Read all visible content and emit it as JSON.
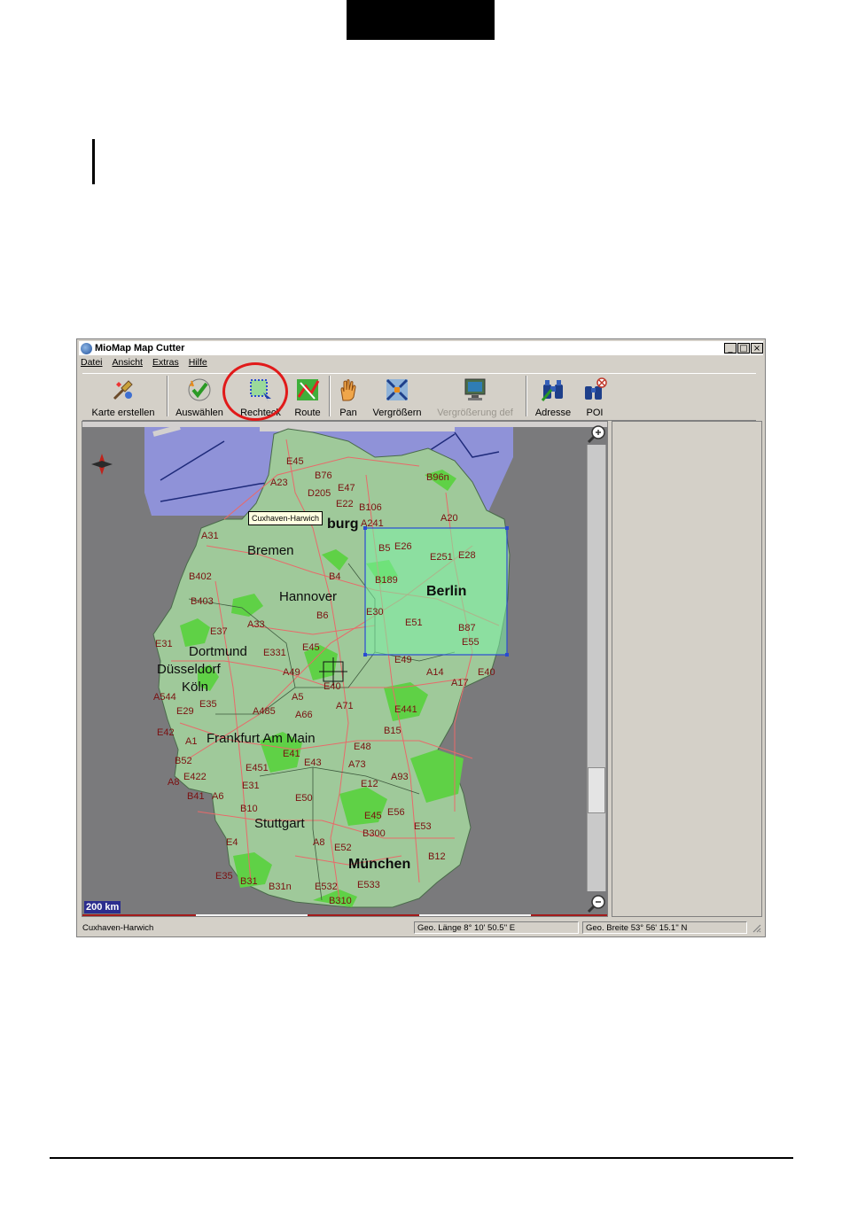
{
  "window": {
    "title": "MioMap Map Cutter",
    "buttons": [
      "_",
      "□",
      "×"
    ]
  },
  "menu": [
    "Datei",
    "Ansicht",
    "Extras",
    "Hilfe"
  ],
  "toolbar": {
    "karte_erstellen": "Karte erstellen",
    "auswaehlen": "Auswählen",
    "rechteck": "Rechteck",
    "route": "Route",
    "pan": "Pan",
    "vergroessern": "Vergrößern",
    "vergroesserung_def": "Vergrößerung def",
    "adresse": "Adresse",
    "poi": "POI"
  },
  "map": {
    "tooltip": "Cuxhaven-Harwich",
    "scale": "200 km",
    "cities": {
      "hamburg": "burg",
      "bremen": "Bremen",
      "hannover": "Hannover",
      "berlin": "Berlin",
      "dortmund": "Dortmund",
      "duesseldorf": "Düsseldorf",
      "koeln": "Köln",
      "frankfurt": "Frankfurt Am Main",
      "stuttgart": "Stuttgart",
      "muenchen": "München"
    },
    "roads": [
      "E45",
      "B76",
      "A23",
      "D205",
      "E47",
      "E22",
      "B106",
      "B96n",
      "A20",
      "A241",
      "A31",
      "B5",
      "E26",
      "E251",
      "E28",
      "B402",
      "B4",
      "B189",
      "B403",
      "B6",
      "E30",
      "A33",
      "E37",
      "E31",
      "E45",
      "E331",
      "E51",
      "B87",
      "E55",
      "A49",
      "E49",
      "A14",
      "E40",
      "A17",
      "E40",
      "A544",
      "E35",
      "A5",
      "A71",
      "E29",
      "A485",
      "A66",
      "E441",
      "E42",
      "A1",
      "B15",
      "E41",
      "E48",
      "B52",
      "E451",
      "E43",
      "A73",
      "A93",
      "A8",
      "E422",
      "E31",
      "E12",
      "B41",
      "A6",
      "B10",
      "E50",
      "E45",
      "E56",
      "E4",
      "E53",
      "A8",
      "B300",
      "E52",
      "B12",
      "E35",
      "B31",
      "B31n",
      "E532",
      "E533",
      "B310"
    ]
  },
  "status": {
    "left": "Cuxhaven-Harwich",
    "lon": "Geo. Länge  8° 10' 50.5'' E",
    "lat": "Geo. Breite 53° 56' 15.1'' N"
  },
  "colors": {
    "land": "#9fc99a",
    "forest": "#5fd146",
    "sea": "#8f92d8",
    "highlight": "#e11a1a",
    "selection": "#2a4bd1",
    "selection_fill": "#7cf0a6"
  }
}
